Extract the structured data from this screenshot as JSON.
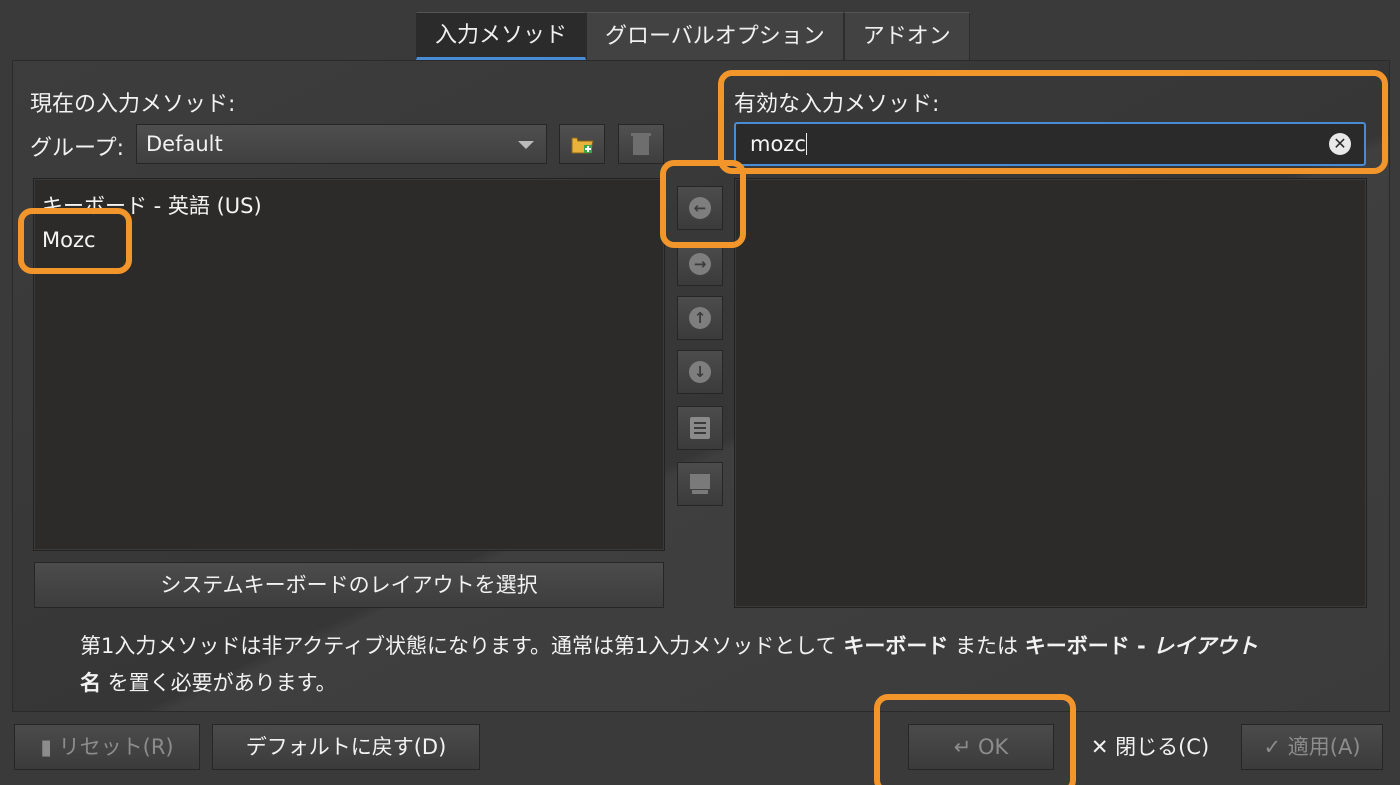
{
  "tabs": [
    {
      "label": "入力メソッド"
    },
    {
      "label": "グローバルオプション"
    },
    {
      "label": "アドオン"
    }
  ],
  "left": {
    "title": "現在の入力メソッド:",
    "group_label": "グループ:",
    "group_value": "Default",
    "items": [
      {
        "label": "キーボード - 英語 (US)"
      },
      {
        "label": "Mozc"
      }
    ],
    "layout_button": "システムキーボードのレイアウトを選択"
  },
  "right": {
    "title": "有効な入力メソッド:",
    "search_value": "mozc"
  },
  "notice": {
    "part1": "第1入力メソッドは非アクティブ状態になります。通常は第1入力メソッドとして ",
    "bold1": "キーボード",
    "part2": " または ",
    "bold2": "キーボード - ",
    "italic": "レイアウト",
    "bold3": "名",
    "part3": " を置く必要があります。"
  },
  "footer": {
    "reset": "リセット(R)",
    "defaults": "デフォルトに戻す(D)",
    "ok": "OK",
    "close": "閉じる(C)",
    "apply": "適用(A)"
  },
  "colors": {
    "highlight": "#f2952a",
    "accent": "#4a8cd4"
  }
}
